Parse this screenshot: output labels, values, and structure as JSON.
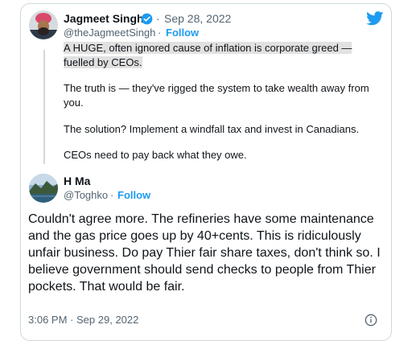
{
  "quoted_tweet": {
    "author_name": "Jagmeet Singh",
    "date": "Sep 28, 2022",
    "handle": "@theJagmeetSingh",
    "separator": "·",
    "follow_label": "Follow",
    "paragraphs": [
      "A HUGE, often ignored cause of inflation is corporate greed — fuelled by CEOs.",
      "The truth is — they've rigged the system to take wealth away from you.",
      "The solution? Implement a windfall tax and invest in Canadians.",
      "CEOs need to pay back what they owe."
    ],
    "highlight_line1": "A HUGE, often ignored cause of inflation is corporate greed —",
    "highlight_line2": "fuelled by CEOs."
  },
  "reply": {
    "author_name": "H Ma",
    "handle": "@Toghko",
    "separator": "·",
    "follow_label": "Follow",
    "text": "Couldn't agree more. The refineries have some maintenance and the gas price goes up by 40+cents. This is ridiculously unfair business. Do pay Thier fair share taxes, don't think so. I believe government should send checks to people from Thier pockets. That would be fair.",
    "time": "3:06 PM",
    "date": "Sep 29, 2022"
  },
  "colors": {
    "accent": "#1d9bf0",
    "muted": "#536471",
    "text": "#0f1419",
    "border": "#cfd9de",
    "highlight": "#e1e1e1"
  },
  "icons": [
    "twitter-bird-icon",
    "verified-badge-icon",
    "info-icon"
  ]
}
